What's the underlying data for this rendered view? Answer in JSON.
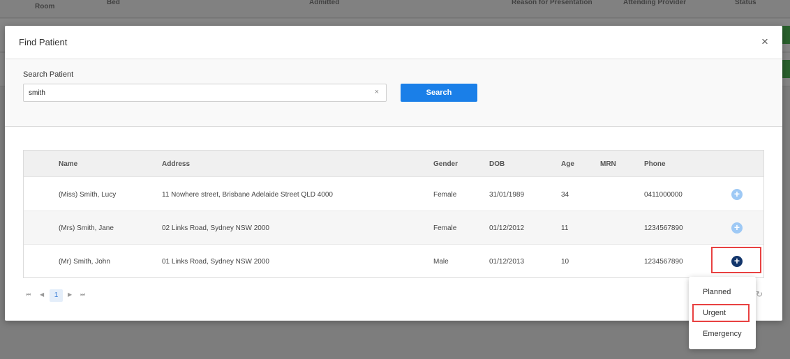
{
  "background": {
    "columns": [
      "Room",
      "Bed",
      "Admitted",
      "Reason for Presentation",
      "Attending Provider",
      "Status"
    ]
  },
  "modal": {
    "title": "Find Patient",
    "close_icon": "×"
  },
  "search": {
    "label": "Search Patient",
    "value": "smith",
    "clear_icon": "×",
    "button_label": "Search"
  },
  "grid": {
    "columns": {
      "name": "Name",
      "address": "Address",
      "gender": "Gender",
      "dob": "DOB",
      "age": "Age",
      "mrn": "MRN",
      "phone": "Phone"
    },
    "rows": [
      {
        "name": "(Miss) Smith, Lucy",
        "address": "11 Nowhere street, Brisbane Adelaide Street QLD 4000",
        "gender": "Female",
        "dob": "31/01/1989",
        "age": "34",
        "mrn": "",
        "phone": "0411000000"
      },
      {
        "name": "(Mrs) Smith, Jane",
        "address": "02 Links Road, Sydney NSW 2000",
        "gender": "Female",
        "dob": "01/12/2012",
        "age": "11",
        "mrn": "",
        "phone": "1234567890"
      },
      {
        "name": "(Mr) Smith, John",
        "address": "01 Links Road, Sydney NSW 2000",
        "gender": "Male",
        "dob": "01/12/2013",
        "age": "10",
        "mrn": "",
        "phone": "1234567890"
      }
    ],
    "add_icon": "+"
  },
  "pager": {
    "first": "⏮",
    "prev": "◀",
    "page": "1",
    "next": "▶",
    "last": "⏭"
  },
  "menu": {
    "items": [
      "Planned",
      "Urgent",
      "Emergency"
    ]
  },
  "colors": {
    "primary": "#1a7fe8",
    "add_light": "#9ec9f5",
    "add_dark": "#12356b",
    "highlight": "#e84141"
  }
}
